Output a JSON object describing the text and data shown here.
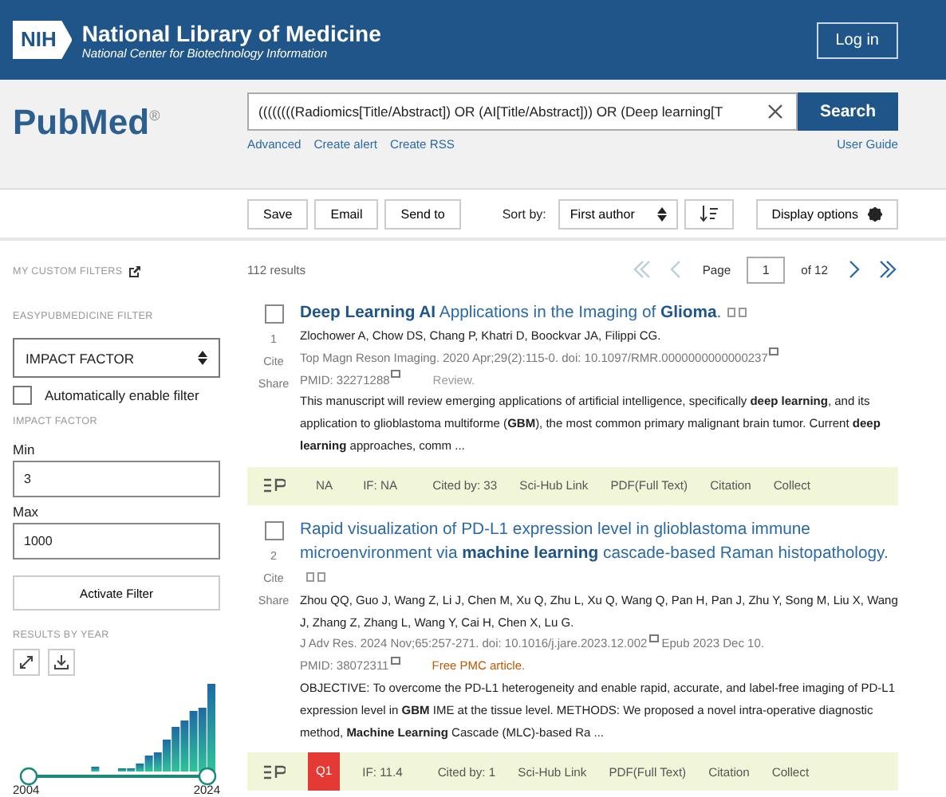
{
  "header": {
    "logo": "NIH",
    "title": "National Library of Medicine",
    "subtitle": "National Center for Biotechnology Information",
    "login": "Log in"
  },
  "search": {
    "logo": "PubMed$^{®}$",
    "query": "((((((((Radiomics[Title/Abstract]) OR (AI[Title/Abstract])) OR (Deep learning[T",
    "button": "Search",
    "links": [
      "Advanced",
      "Create alert",
      "Create RSS"
    ],
    "user_guide": "User Guide"
  },
  "toolbar": {
    "actions": [
      "Save",
      "Email",
      "Send to"
    ],
    "sort_label": "Sort by:",
    "sort_value": "First author",
    "display": "Display options"
  },
  "sidebar": {
    "custom_filters": "MY CUSTOM FILTERS",
    "easy_filter": "EASYPUBMEDICINE FILTER",
    "filter_select": "IMPACT FACTOR",
    "auto_enable": {
      "label": "Automatically enable filter",
      "checked": false
    },
    "section": "IMPACT FACTOR",
    "min": {
      "label": "Min",
      "value": "3"
    },
    "max": {
      "label": "Max",
      "value": "1000"
    },
    "activate": "Activate Filter",
    "results_by_year": "RESULTS BY YEAR",
    "year_start": "2004",
    "year_end": "2024",
    "year_slider": {
      "level": 1
    }
  },
  "results": {
    "count": "112 results",
    "page_label": "Page",
    "page": "1",
    "of": "of 12"
  },
  "articles": [
    {
      "selected": false,
      "number": "1",
      "cite": "Cite",
      "share": "Share",
      "title": "**Deep Learning AI** Applications in the Imaging of **Glioma**.",
      "authors": "Zlochower A, Chow DS, Chang P, Khatri D, Boockvar JA, Filippi CG.",
      "citation": "Top Magn Reson Imaging. 2020 Apr;29(2):115-0. doi: 10.1097/RMR.0000000000000237",
      "pmid": "PMID: 32271288",
      "note": {
        "kind": "type",
        "text": "Review."
      },
      "abstract": "This manuscript will review emerging applications of artificial intelligence, specifically **deep learning**, and its application to glioblastoma multiforme (**GBM**), the most common primary malignant brain tumor. Current **deep learning** approaches, comm ...",
      "footer": {
        "quartile": {
          "text": "NA"
        },
        "impact": "IF: NA",
        "cited": "Cited by: 33",
        "links": [
          "Sci-Hub Link",
          "PDF(Full Text)",
          "Citation",
          "Collect"
        ]
      }
    },
    {
      "selected": false,
      "number": "2",
      "cite": "Cite",
      "share": "Share",
      "title": "Rapid visualization of PD-L1 expression level in glioblastoma immune microenvironment via **machine learning** cascade-based Raman histopathology.",
      "authors": "Zhou QQ, Guo J, Wang Z, Li J, Chen M, Xu Q, Zhu L, Xu Q, Wang Q, Pan H, Pan J, Zhu Y, Song M, Liu X, Wang J, Zhang Z, Zhang L, Wang Y, Cai H, Chen X, Lu G.",
      "citation": "J Adv Res. 2024 Nov;65:257-271. doi: 10.1016/j.jare.2023.12.002",
      "epub": "Epub 2023 Dec 10.",
      "pmid": "PMID: 38072311",
      "note": {
        "kind": "free",
        "text": "Free PMC article."
      },
      "abstract": "OBJECTIVE: To overcome the PD-L1 heterogeneity and enable rapid, accurate, and label-free imaging of PD-L1 expression level in **GBM** IME at the tissue level. METHODS: We proposed a novel intra-operative diagnostic method, **Machine Learning** Cascade (MLC)-based Ra ...",
      "footer": {
        "quartile": {
          "text": "Q1",
          "color": "#e53935"
        },
        "impact": "IF: 11.4",
        "cited": "Cited by: 1",
        "links": [
          "Sci-Hub Link",
          "PDF(Full Text)",
          "Citation",
          "Collect"
        ]
      }
    }
  ]
}
